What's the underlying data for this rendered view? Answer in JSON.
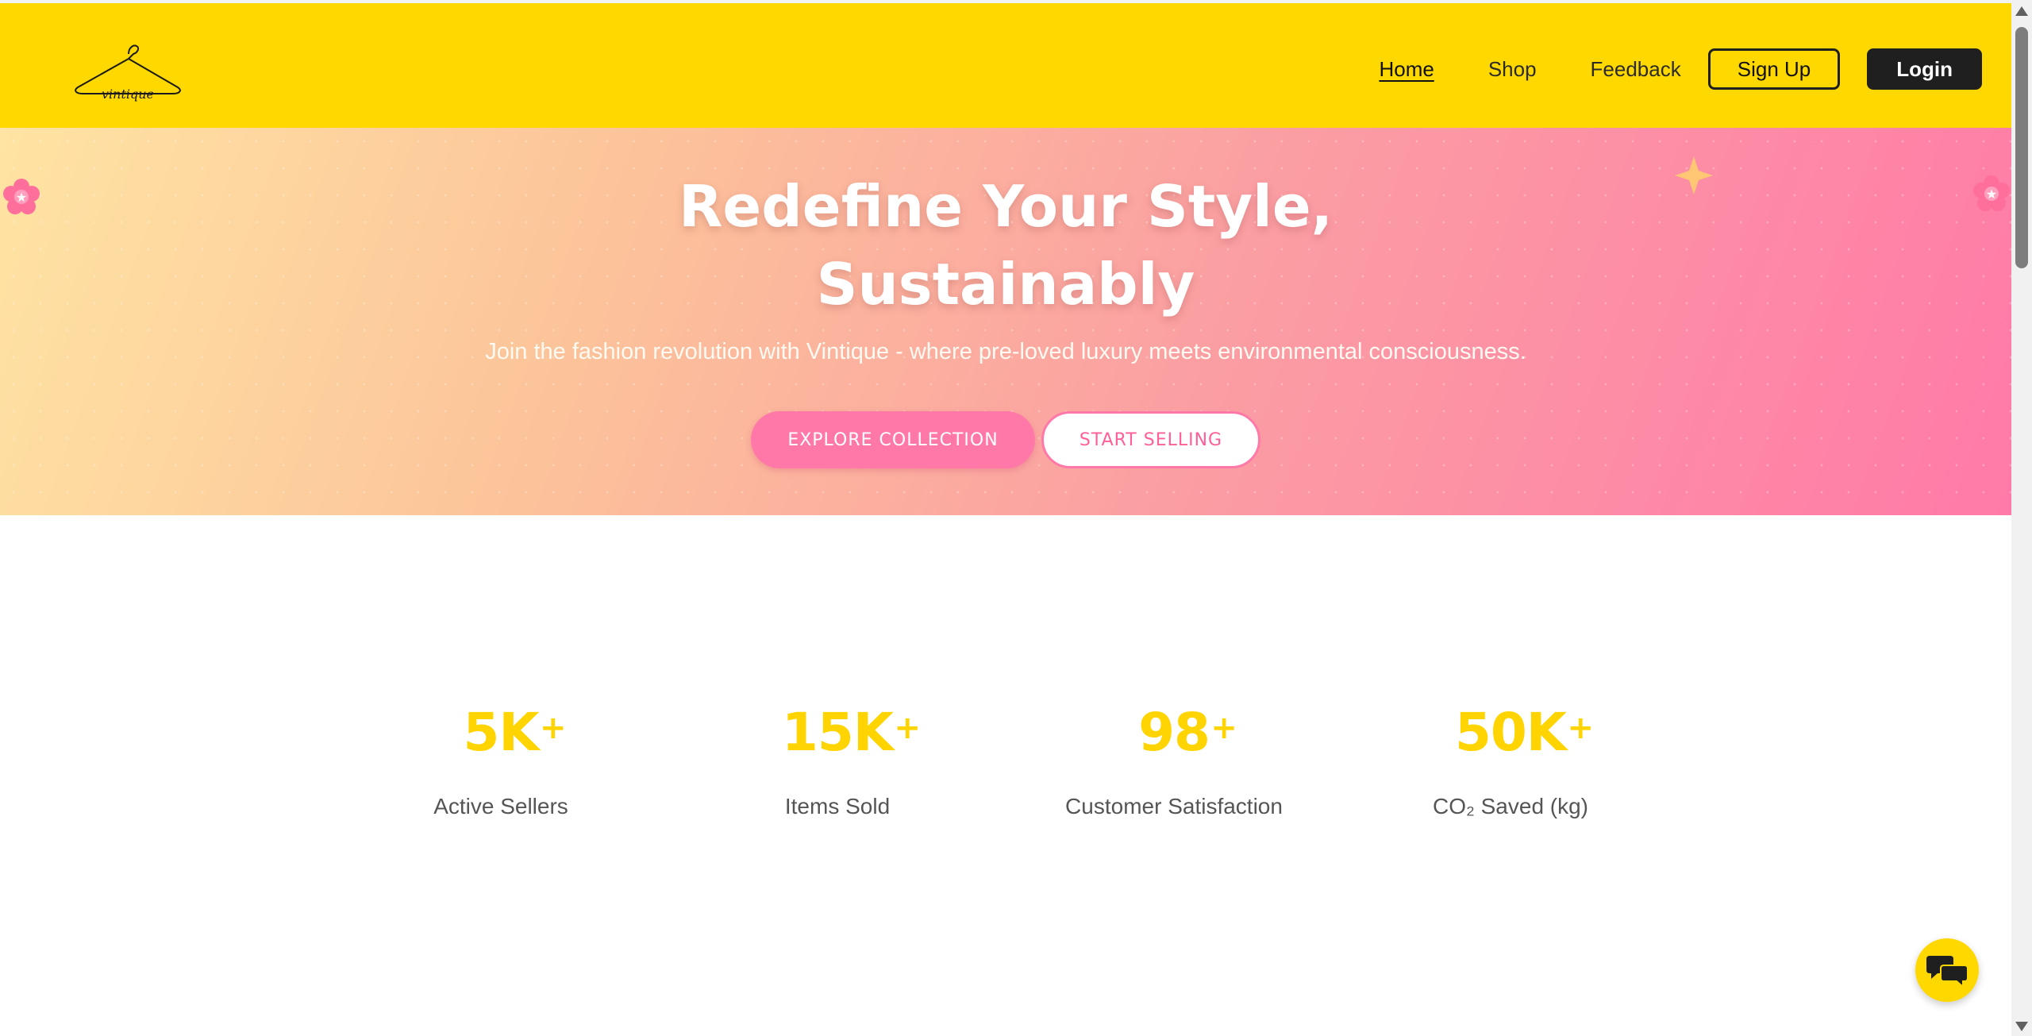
{
  "header": {
    "logo_alt": "vintique",
    "nav": [
      {
        "label": "Home",
        "active": true
      },
      {
        "label": "Shop",
        "active": false
      },
      {
        "label": "Feedback",
        "active": false
      }
    ],
    "signup_label": "Sign Up",
    "login_label": "Login"
  },
  "hero": {
    "title_line1": "Redefine Your Style,",
    "title_line2": "Sustainably",
    "subtitle": "Join the fashion revolution with Vintique - where pre-loved luxury meets environmental consciousness.",
    "explore_label": "EXPLORE COLLECTION",
    "sell_label": "START SELLING"
  },
  "stats": [
    {
      "value": "5K",
      "suffix": "+",
      "label": "Active Sellers"
    },
    {
      "value": "15K",
      "suffix": "+",
      "label": "Items Sold"
    },
    {
      "value": "98",
      "suffix": "+",
      "label": "Customer Satisfaction"
    },
    {
      "value": "50K",
      "suffix": "+",
      "label": "CO₂ Saved (kg)"
    }
  ],
  "icons": {
    "chat": "chat-bubbles-icon",
    "flower": "flower-icon",
    "sparkle": "sparkle-icon",
    "logo": "hanger-logo-icon"
  },
  "colors": {
    "header_bg": "#ffd800",
    "accent_pink": "#ff78a8",
    "stat_yellow": "#ffd400",
    "dark": "#1f1f1f"
  }
}
